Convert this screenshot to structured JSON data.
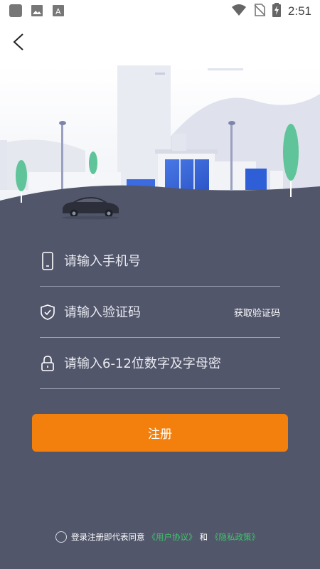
{
  "status_bar": {
    "time": "2:51",
    "left_icons": [
      "app-icon",
      "image-icon",
      "font-icon"
    ],
    "right_icons": [
      "wifi-icon",
      "no-sim-icon",
      "battery-charging-icon"
    ]
  },
  "header": {
    "back_icon": "chevron-left-icon"
  },
  "form": {
    "phone": {
      "placeholder": "请输入手机号",
      "icon": "phone-icon"
    },
    "code": {
      "placeholder": "请输入验证码",
      "icon": "shield-check-icon",
      "get_code_label": "获取验证码"
    },
    "password": {
      "placeholder": "请输入6-12位数字及字母密码",
      "icon": "lock-icon"
    }
  },
  "register_button": {
    "label": "注册"
  },
  "agreement": {
    "prefix": "登录注册即代表同意",
    "user_agreement": "《用户协议》",
    "and": "和",
    "privacy_policy": "《隐私政策》"
  },
  "colors": {
    "background": "#51566b",
    "accent": "#f37f0c",
    "link": "#3ec66a"
  }
}
